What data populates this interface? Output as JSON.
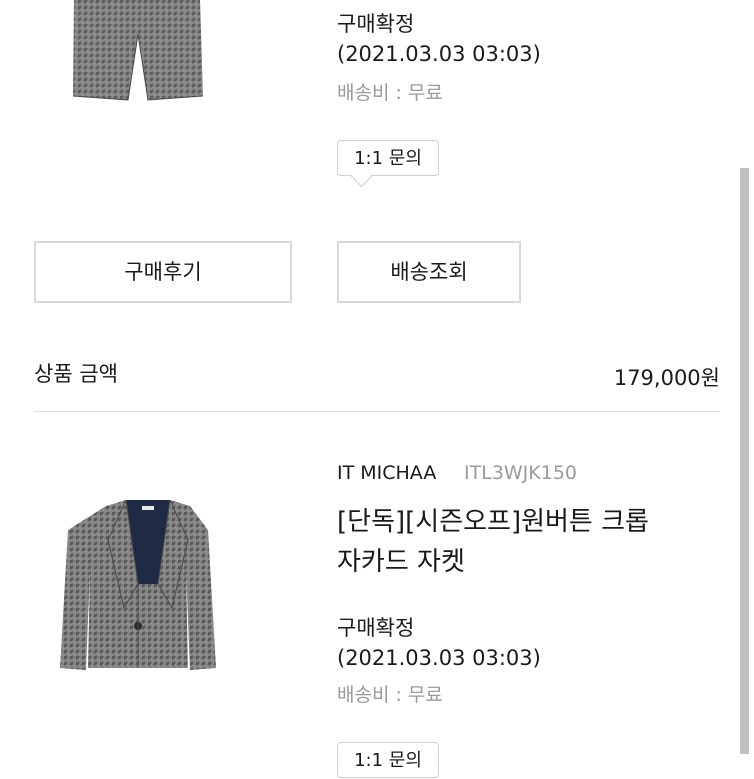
{
  "order1": {
    "status": "구매확정",
    "date": "(2021.03.03 03:03)",
    "shipping": "배송비 : 무료",
    "inquiry_label": "1:1 문의",
    "review_button": "구매후기",
    "tracking_button": "배송조회"
  },
  "summary": {
    "label": "상품 금액",
    "amount": "179,000원"
  },
  "order2": {
    "brand": "IT MICHAA",
    "product_code": "ITL3WJK150",
    "product_name_line1": "[단독][시즌오프]원버튼 크롭",
    "product_name_line2": "자카드 자켓",
    "status": "구매확정",
    "date": "(2021.03.03 03:03)",
    "shipping": "배송비 : 무료",
    "inquiry_label": "1:1 문의"
  },
  "colors": {
    "border": "#d9d9d9",
    "muted_text": "#9a9a9a",
    "scrollbar": "#bfbfbf",
    "product_fabric": "#6f6f6f"
  },
  "icons": {
    "product1_image": "tweed-shorts-image",
    "product2_image": "tweed-cropped-jacket-image"
  }
}
